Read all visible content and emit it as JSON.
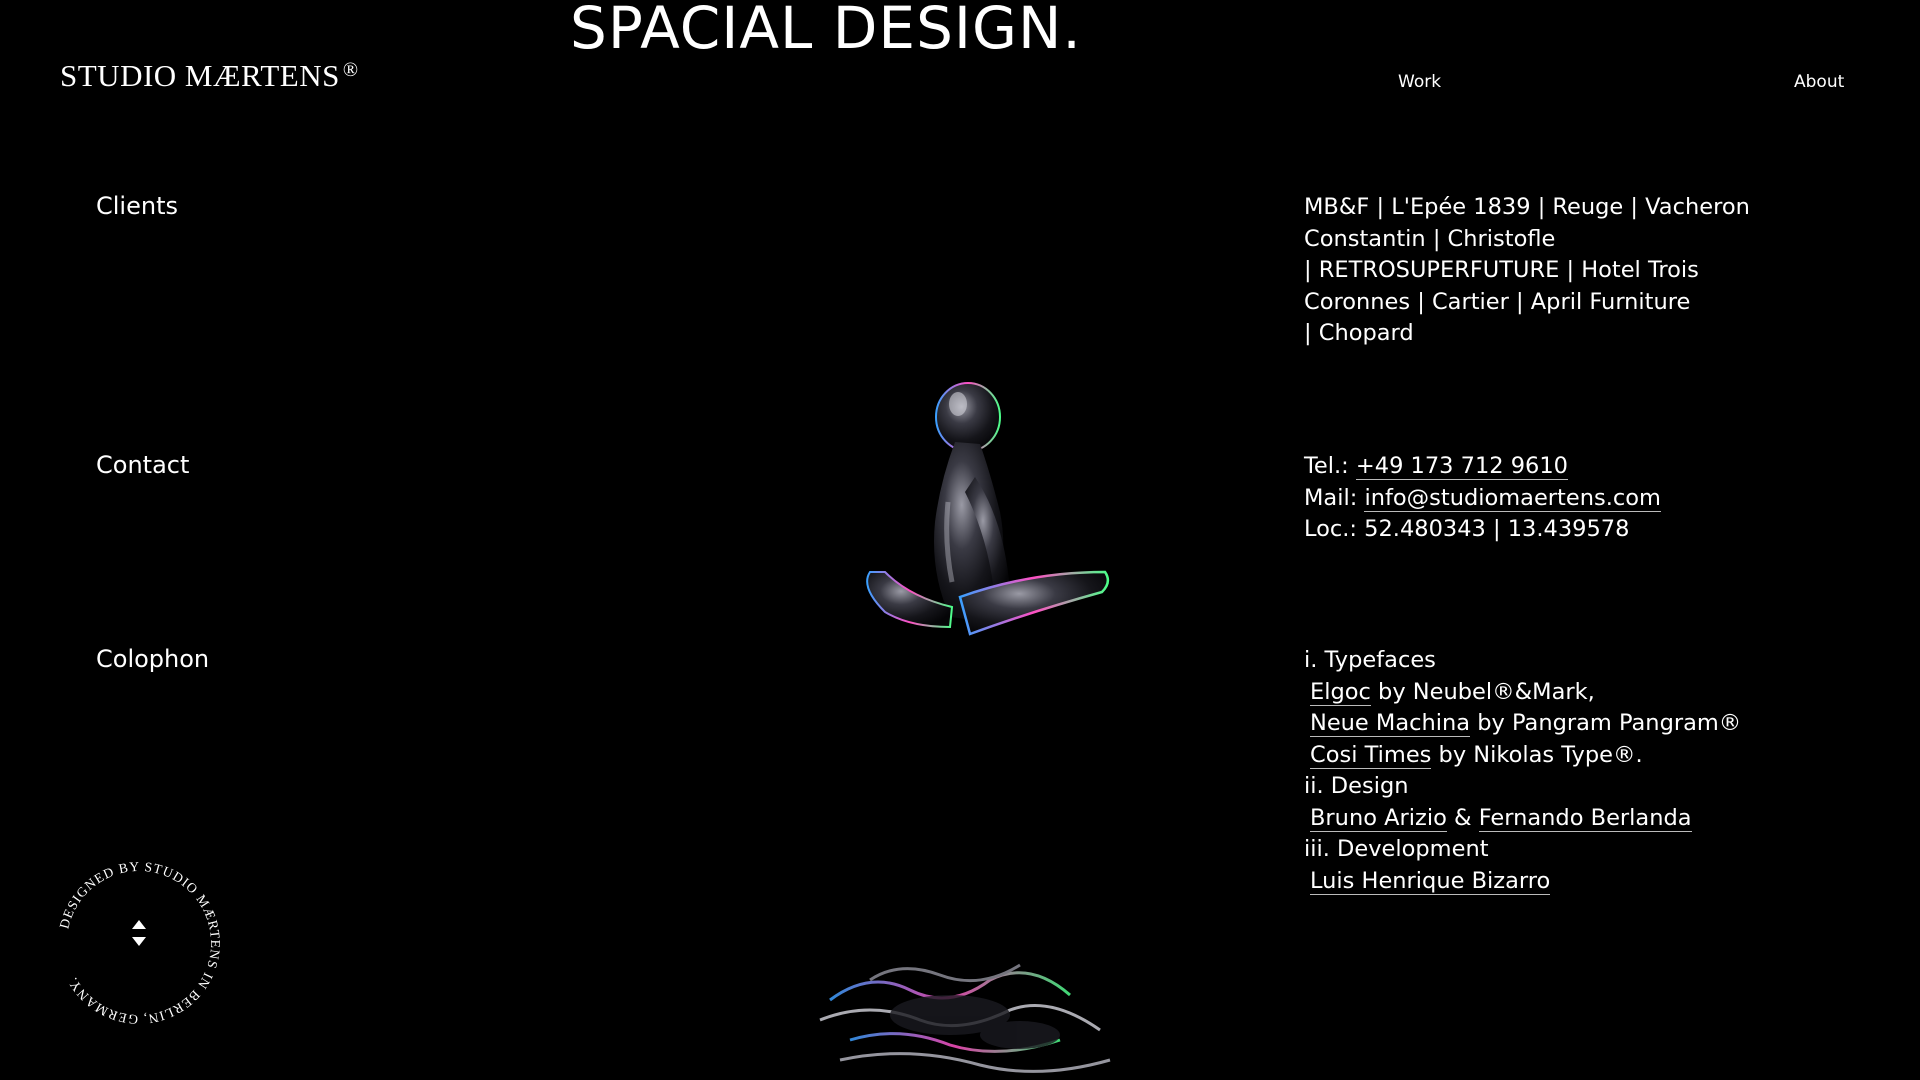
{
  "hero": {
    "title": "SPACIAL DESIGN."
  },
  "header": {
    "logo_text": "STUDIO MÆRTENS",
    "logo_mark": "®",
    "nav": {
      "work": "Work",
      "about": "About"
    }
  },
  "sections": {
    "clients": {
      "label": "Clients",
      "lines": [
        "MB&F | L'Epée 1839 | Reuge | Vacheron",
        "Constantin | Christofle",
        "| RETROSUPERFUTURE | Hotel Trois",
        "Coronnes | Cartier | April Furniture",
        "| Chopard"
      ]
    },
    "contact": {
      "label": "Contact",
      "tel_label": "Tel.:",
      "tel": "+49 173 712 9610",
      "mail_label": "Mail:",
      "mail": "info@studiomaertens.com",
      "loc": "Loc.: 52.480343 | 13.439578"
    },
    "colophon": {
      "label": "Colophon",
      "typefaces_heading": "i. Typefaces",
      "tf1_link": "Elgoc",
      "tf1_rest": "by Neubel®&Mark,",
      "tf2_link": "Neue Machina",
      "tf2_rest": "by Pangram Pangram®",
      "tf3_link": "Cosi Times",
      "tf3_rest": "by Nikolas Type®.",
      "design_heading": "ii. Design",
      "designer1": "Bruno Arizio",
      "design_amp": "&",
      "designer2": "Fernando Berlanda",
      "dev_heading": "iii. Development",
      "developer": "Luis Henrique Bizarro"
    }
  },
  "badge": {
    "text": "DESIGNED BY STUDIO MÆRTENS IN BERLIN, GERMANY. "
  },
  "colors": {
    "background": "#000000",
    "text": "#ffffff"
  }
}
